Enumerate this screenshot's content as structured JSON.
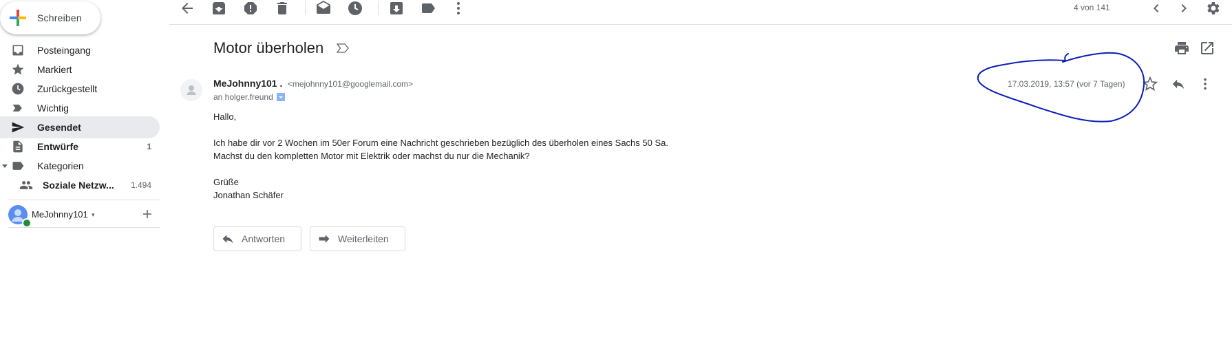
{
  "compose": {
    "label": "Schreiben"
  },
  "sidebar": {
    "items": [
      {
        "label": "Posteingang",
        "icon": "inbox-icon",
        "count": ""
      },
      {
        "label": "Markiert",
        "icon": "star-icon",
        "count": ""
      },
      {
        "label": "Zurückgestellt",
        "icon": "clock-icon",
        "count": ""
      },
      {
        "label": "Wichtig",
        "icon": "important-icon",
        "count": ""
      },
      {
        "label": "Gesendet",
        "icon": "send-icon",
        "count": "",
        "active": true
      },
      {
        "label": "Entwürfe",
        "icon": "draft-icon",
        "count": "1"
      },
      {
        "label": "Kategorien",
        "icon": "label-icon",
        "count": ""
      }
    ],
    "subitems": [
      {
        "label": "Soziale Netzw...",
        "icon": "people-icon",
        "count": "1.494"
      }
    ]
  },
  "hangouts": {
    "user": "MeJohnny101",
    "status_color": "#1e8e3e"
  },
  "toolbar": {
    "pagination": "4 von 141"
  },
  "message": {
    "subject": "Motor überholen",
    "sender_name": "MeJohnny101 .",
    "sender_email": "<mejohnny101@googlemail.com>",
    "recipients": "an holger.freund",
    "date": "17.03.2019, 13:57 (vor 7 Tagen)",
    "body": [
      "Hallo,",
      "",
      "Ich habe dir vor 2 Wochen im 50er Forum eine Nachricht geschrieben bezüglich des überholen eines Sachs 50 Sa.",
      "Machst du den kompletten Motor mit Elektrik oder machst du nur die Mechanik?",
      "",
      "Grüße",
      "Jonathan Schäfer"
    ]
  },
  "actions": {
    "reply_label": "Antworten",
    "forward_label": "Weiterleiten"
  },
  "colors": {
    "accent": "#1a73e8",
    "annotation": "#0a1fb8"
  }
}
